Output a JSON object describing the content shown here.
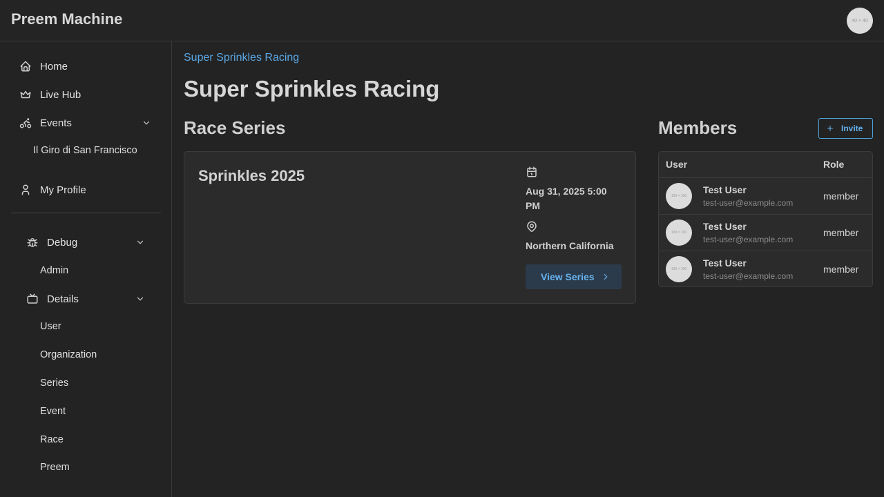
{
  "header": {
    "app_title": "Preem Machine",
    "avatar_placeholder": "40 × 40"
  },
  "sidebar": {
    "home": "Home",
    "live_hub": "Live Hub",
    "events": "Events",
    "event_sub": "Il Giro di San Francisco",
    "my_profile": "My Profile",
    "debug": "Debug",
    "admin": "Admin",
    "details": "Details",
    "details_items": [
      "User",
      "Organization",
      "Series",
      "Event",
      "Race",
      "Preem"
    ]
  },
  "main": {
    "breadcrumb": "Super Sprinkles Racing",
    "title": "Super Sprinkles Racing",
    "race_series_heading": "Race Series",
    "series": {
      "name": "Sprinkles 2025",
      "date": "Aug 31, 2025 5:00 PM",
      "location": "Northern California",
      "view_button": "View Series"
    },
    "members_heading": "Members",
    "invite_button": "Invite",
    "table": {
      "headers": [
        "User",
        "Role"
      ],
      "avatar_placeholder": "100 × 100",
      "rows": [
        {
          "name": "Test User",
          "email": "test-user@example.com",
          "role": "member"
        },
        {
          "name": "Test User",
          "email": "test-user@example.com",
          "role": "member"
        },
        {
          "name": "Test User",
          "email": "test-user@example.com",
          "role": "member"
        }
      ]
    }
  },
  "colors": {
    "accent": "#5aa8e6",
    "background": "#232323",
    "card": "#2b2b2b"
  }
}
